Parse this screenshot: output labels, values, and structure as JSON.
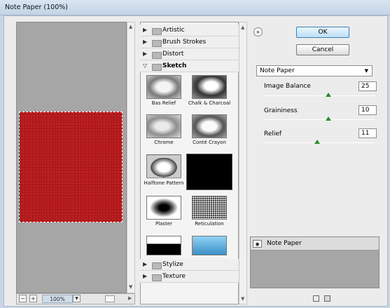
{
  "window": {
    "title": "Note Paper (100%)"
  },
  "preview": {
    "zoom": "100%",
    "minus": "−",
    "plus": "+"
  },
  "gallery": {
    "categories_top": [
      "Artistic",
      "Brush Strokes",
      "Distort"
    ],
    "open_category": "Sketch",
    "thumbnails": [
      "Bas Relief",
      "Chalk & Charcoal",
      "Chrome",
      "Conté Crayon",
      "Halftone Pattern",
      "Plaster",
      "Reticulation"
    ],
    "categories_bottom": [
      "Stylize",
      "Texture"
    ]
  },
  "buttons": {
    "ok": "OK",
    "cancel": "Cancel",
    "toggle": "»"
  },
  "filter_select": {
    "value": "Note Paper"
  },
  "params": [
    {
      "label": "Image Balance",
      "value": "25",
      "fraction": 0.58
    },
    {
      "label": "Graininess",
      "value": "10",
      "fraction": 0.58
    },
    {
      "label": "Relief",
      "value": "11",
      "fraction": 0.48
    }
  ],
  "layers": {
    "item": "Note Paper"
  },
  "colors": {
    "accent_knob": "#2e8b2e",
    "preview_paper": "#b5191b"
  }
}
